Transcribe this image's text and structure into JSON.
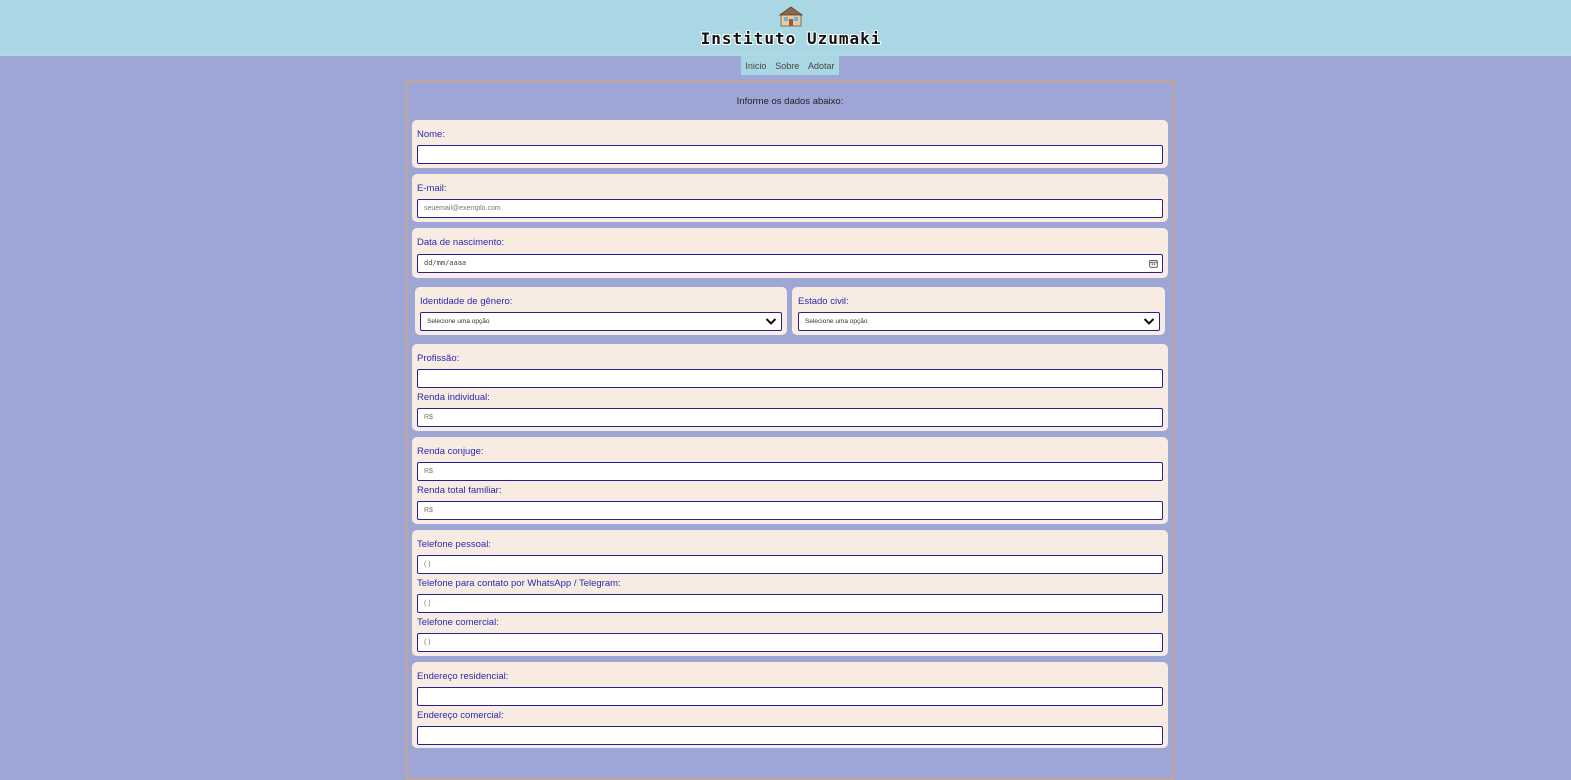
{
  "header": {
    "title": "Instituto Uzumaki",
    "logo_icon": "house-icon"
  },
  "nav": {
    "items": [
      "Inicio",
      "Sobre",
      "Adotar"
    ]
  },
  "form": {
    "intro": "Informe os dados abaixo:",
    "nome": {
      "label": "Nome:",
      "value": ""
    },
    "email": {
      "label": "E-mail:",
      "placeholder": "seuemail@exemplo.com"
    },
    "nascimento": {
      "label": "Data de nascimento:",
      "placeholder": "dd/mm/aaaa"
    },
    "genero": {
      "label": "Identidade de gênero:",
      "selected": "Selecione uma opção"
    },
    "estado_civil": {
      "label": "Estado civil:",
      "selected": "Selecione uma opção"
    },
    "profissao": {
      "label": "Profissão:",
      "value": ""
    },
    "renda_individual": {
      "label": "Renda individual:",
      "placeholder": "R$"
    },
    "renda_conjuge": {
      "label": "Renda conjuge:",
      "placeholder": "R$"
    },
    "renda_total": {
      "label": "Renda total familiar:",
      "placeholder": "R$"
    },
    "telefone_pessoal": {
      "label": "Telefone pessoal:",
      "placeholder": "(  )"
    },
    "telefone_whatsapp": {
      "label": "Telefone para contato por WhatsApp / Telegram:",
      "placeholder": "(  )"
    },
    "telefone_comercial": {
      "label": "Telefone comercial:",
      "placeholder": "(  )"
    },
    "endereco_residencial": {
      "label": "Endereço residencial:",
      "value": ""
    },
    "endereco_comercial": {
      "label": "Endereço comercial:",
      "value": ""
    }
  },
  "colors": {
    "page_bg": "#9ea6d6",
    "header_bg": "#a9d8e4",
    "card_bg": "#f8ebe1",
    "label": "#2a2ab0",
    "field_border": "#25248f",
    "frame_border": "#e3a35c"
  }
}
